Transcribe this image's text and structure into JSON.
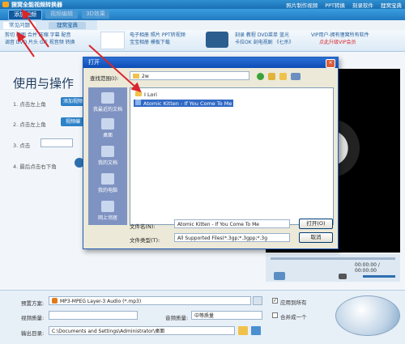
{
  "app": {
    "title": "狸窝全能视频转换器",
    "title_links": [
      "照片制作视频",
      "PPT转换",
      "刻录软件",
      "狸窝宝典"
    ]
  },
  "toolbar": {
    "add_video": "添加视频",
    "btn2": "视频编辑",
    "btn3": "3D效果"
  },
  "tabs": {
    "tab1": "常见问题",
    "tab2": "狸窝宝典"
  },
  "ribbon": {
    "left_lines": [
      "剪切 截图 合并 压缩 字幕 配音",
      "调音 DVD 片头 GIF 视音频 转换"
    ],
    "ppt_lines": [
      "电子相册 照片 PPT转视频",
      "宝宝相册 模板下载"
    ],
    "dvd_lines": [
      "刻录 教程 DVD菜单 蓝光",
      "卡拉OK 刻电视剧 《七杀》"
    ],
    "vip_lines": [
      "VIP用户-拥有狸窝所有软件",
      "点此升级VIP会员"
    ]
  },
  "main": {
    "heading": "使用与操作",
    "step1": "1. 点击左上角",
    "step1_btn": "添加视频",
    "step2": "2. 点击左上角",
    "step2_btn": "视频编",
    "step3": "3. 点击",
    "step4": "4. 最后点击右下角"
  },
  "player": {
    "time": "00:00:00 / 00:00:00"
  },
  "settings": {
    "preset_label": "预置方案:",
    "preset_value": "MP3-MPEG Layer-3 Audio (*.mp3)",
    "video_quality_label": "视频质量:",
    "audio_quality_label": "音频质量:",
    "audio_quality_value": "中等质量",
    "apply_all_label": "应用到所有",
    "merge_label": "合并成一个",
    "output_label": "输出目录:",
    "output_value": "C:\\Documents and Settings\\Administrator\\桌面"
  },
  "dialog": {
    "title": "打开",
    "lookin_label": "查找范围(I):",
    "lookin_value": "2w",
    "places": [
      "我最近的文档",
      "桌面",
      "我的文档",
      "我的电脑",
      "网上邻居"
    ],
    "files": [
      "I Lori",
      "Atomic Kitten - If You Come To Me"
    ],
    "filename_label": "文件名(N):",
    "filename_value": "Atomic Kitten - If You Come To Me",
    "filetype_label": "文件类型(T):",
    "filetype_value": "All Supported Files(*.3gp;*.3gpp;*.3g",
    "open_label": "打开(O)",
    "cancel_label": "取消"
  },
  "colors": {
    "accent": "#2279c0",
    "annotation": "#d9262c",
    "selection": "#316ac5"
  }
}
